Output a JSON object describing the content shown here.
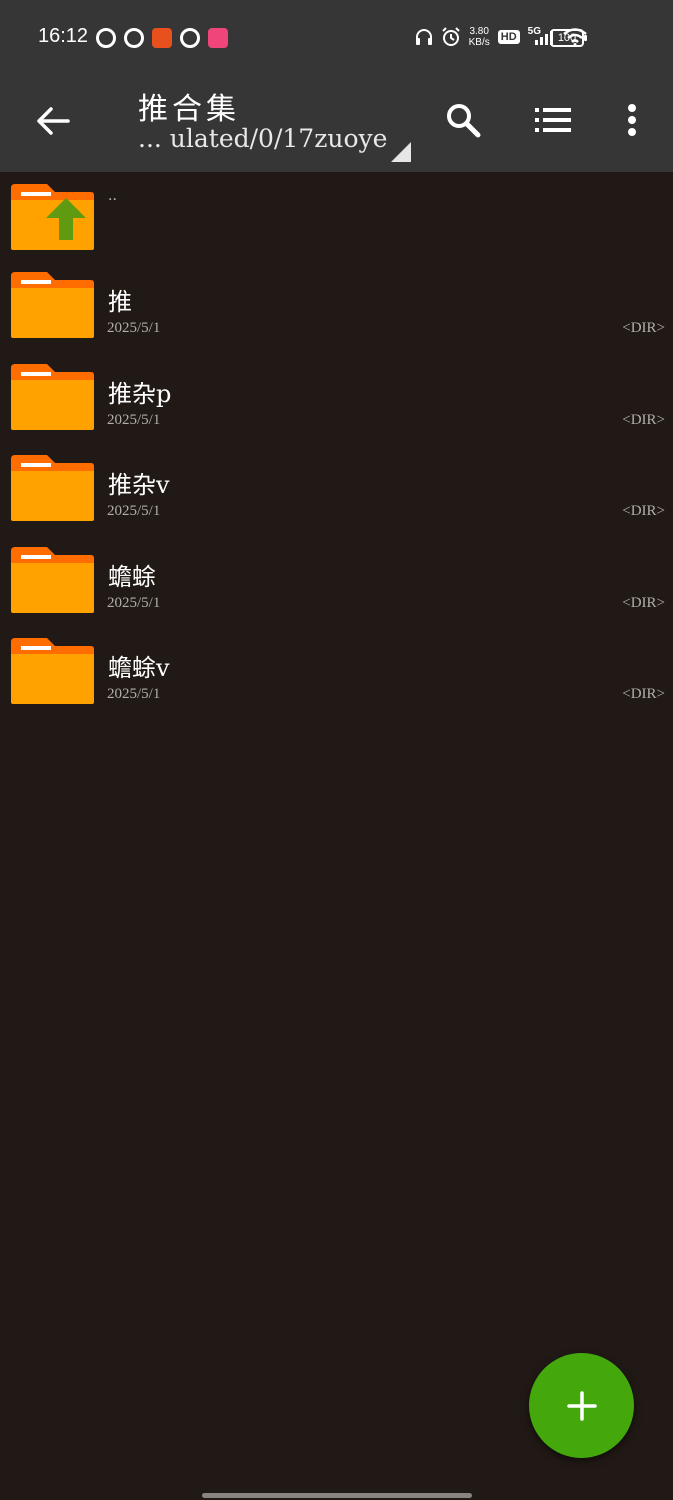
{
  "status_bar": {
    "time": "16:12",
    "net_speed_value": "3.80",
    "net_speed_unit": "KB/s",
    "hd_label": "HD",
    "network_label": "5G",
    "battery_level": "100"
  },
  "toolbar": {
    "title": "推合集",
    "path": "... ulated/0/17zuoye"
  },
  "files": [
    {
      "name": "..",
      "date": "",
      "type": ""
    },
    {
      "name": "推",
      "date": "2025/5/1",
      "type": "<DIR>"
    },
    {
      "name": "推杂p",
      "date": "2025/5/1",
      "type": "<DIR>"
    },
    {
      "name": "推杂v",
      "date": "2025/5/1",
      "type": "<DIR>"
    },
    {
      "name": "蟾蜍",
      "date": "2025/5/1",
      "type": "<DIR>"
    },
    {
      "name": "蟾蜍v",
      "date": "2025/5/1",
      "type": "<DIR>"
    }
  ],
  "colors": {
    "folder": "#ffa200",
    "folder_tab": "#ff6d00",
    "up_arrow": "#5f9a10",
    "fab": "#44a80d"
  },
  "icons": [
    "back-arrow-icon",
    "search-icon",
    "list-view-icon",
    "more-vert-icon",
    "folder-icon",
    "folder-up-icon",
    "add-icon"
  ]
}
